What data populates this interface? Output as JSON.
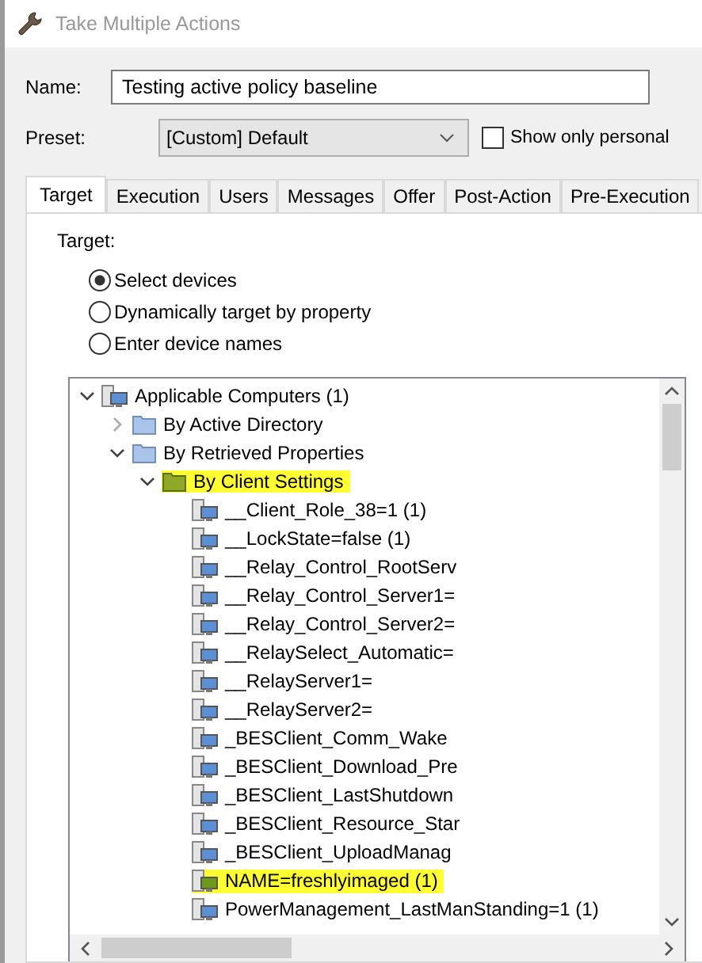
{
  "window": {
    "title": "Take Multiple Actions"
  },
  "name_field": {
    "label": "Name:",
    "value": "Testing active policy baseline"
  },
  "preset": {
    "label": "Preset:",
    "value": "[Custom] Default"
  },
  "show_only_personal": {
    "label": "Show only personal",
    "checked": false
  },
  "tabs": [
    {
      "label": "Target",
      "selected": true
    },
    {
      "label": "Execution",
      "selected": false
    },
    {
      "label": "Users",
      "selected": false
    },
    {
      "label": "Messages",
      "selected": false
    },
    {
      "label": "Offer",
      "selected": false
    },
    {
      "label": "Post-Action",
      "selected": false
    },
    {
      "label": "Pre-Execution",
      "selected": false
    }
  ],
  "target": {
    "label": "Target:",
    "options": [
      {
        "label": "Select devices",
        "selected": true
      },
      {
        "label": "Dynamically target by property",
        "selected": false
      },
      {
        "label": "Enter device names",
        "selected": false
      }
    ]
  },
  "tree": [
    {
      "label": "Applicable Computers (1)",
      "kind": "computer",
      "expanded": true,
      "highlighted": false,
      "children": [
        {
          "label": "By Active Directory",
          "kind": "folder",
          "expanded": false,
          "highlighted": false
        },
        {
          "label": "By Retrieved Properties",
          "kind": "folder",
          "expanded": true,
          "highlighted": false,
          "children": [
            {
              "label": "By Client Settings",
              "kind": "folder",
              "expanded": true,
              "highlighted": true,
              "children": [
                {
                  "label": "__Client_Role_38=1 (1)",
                  "kind": "computer",
                  "highlighted": false
                },
                {
                  "label": "__LockState=false (1)",
                  "kind": "computer",
                  "highlighted": false
                },
                {
                  "label": "__Relay_Control_RootServ",
                  "kind": "computer",
                  "highlighted": false
                },
                {
                  "label": "__Relay_Control_Server1=",
                  "kind": "computer",
                  "highlighted": false
                },
                {
                  "label": "__Relay_Control_Server2=",
                  "kind": "computer",
                  "highlighted": false
                },
                {
                  "label": "__RelaySelect_Automatic=",
                  "kind": "computer",
                  "highlighted": false
                },
                {
                  "label": "__RelayServer1=",
                  "kind": "computer",
                  "highlighted": false
                },
                {
                  "label": "__RelayServer2=",
                  "kind": "computer",
                  "highlighted": false
                },
                {
                  "label": "_BESClient_Comm_Wake",
                  "kind": "computer",
                  "highlighted": false
                },
                {
                  "label": "_BESClient_Download_Pre",
                  "kind": "computer",
                  "highlighted": false
                },
                {
                  "label": "_BESClient_LastShutdown",
                  "kind": "computer",
                  "highlighted": false
                },
                {
                  "label": "_BESClient_Resource_Star",
                  "kind": "computer",
                  "highlighted": false
                },
                {
                  "label": "_BESClient_UploadManag",
                  "kind": "computer",
                  "highlighted": false
                },
                {
                  "label": "NAME=freshlyimaged (1)",
                  "kind": "computer",
                  "highlighted": true
                },
                {
                  "label": "PowerManagement_LastManStanding=1 (1)",
                  "kind": "computer",
                  "highlighted": false
                }
              ]
            }
          ]
        }
      ]
    }
  ]
}
